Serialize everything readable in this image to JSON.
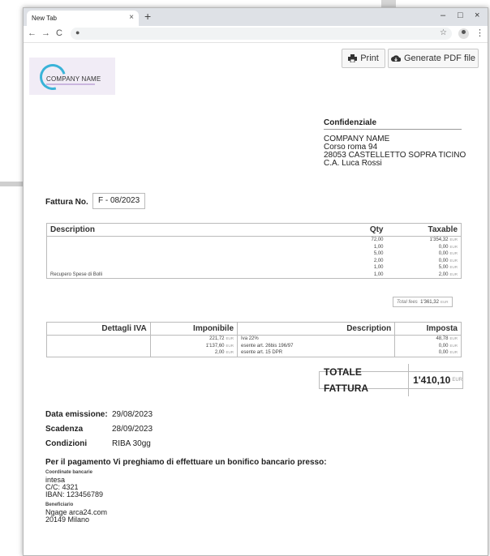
{
  "browser": {
    "tab_title": "New Tab",
    "tab_close": "×",
    "new_tab": "+",
    "minimize": "–",
    "maximize": "□",
    "close": "×",
    "back": "←",
    "forward": "→",
    "reload": "C",
    "lock": "●",
    "star": "☆",
    "menu": "⋮"
  },
  "actions": {
    "print_label": "Print",
    "pdf_label": "Generate PDF file"
  },
  "logo": {
    "text": "COMPANY NAME"
  },
  "recipient": {
    "heading": "Confidenziale",
    "lines": [
      "COMPANY NAME",
      "Corso roma 94",
      "28053 CASTELLETTO SOPRA TICINO",
      "C.A. Luca Rossi"
    ]
  },
  "invoice": {
    "label": "Fattura No.",
    "number": "F - 08/2023"
  },
  "items": {
    "headers": {
      "description": "Description",
      "qty": "Qty",
      "taxable": "Taxable"
    },
    "rows": [
      {
        "description": "",
        "qty": "72,00",
        "taxable": "1'354,32"
      },
      {
        "description": "",
        "qty": "1,00",
        "taxable": "0,00"
      },
      {
        "description": "",
        "qty": "5,00",
        "taxable": "0,00"
      },
      {
        "description": "",
        "qty": "2,00",
        "taxable": "0,00"
      },
      {
        "description": "",
        "qty": "1,00",
        "taxable": "5,00"
      },
      {
        "description": "Recupero Spese di Bolli",
        "qty": "1,00",
        "taxable": "2,00"
      }
    ],
    "currency": "EUR",
    "total_fees_label": "Total fees",
    "total_fees_value": "1'361,32"
  },
  "vat": {
    "headers": {
      "details": "Dettagli IVA",
      "taxable": "Imponibile",
      "description": "Description",
      "tax": "Imposta"
    },
    "rows": [
      {
        "taxable": "221,72",
        "description": "Iva 22%",
        "tax": "48,78"
      },
      {
        "taxable": "1'137,60",
        "description": "esente art. 26bis 196/97",
        "tax": "0,00"
      },
      {
        "taxable": "2,00",
        "description": "esente art. 15 DPR",
        "tax": "0,00"
      }
    ]
  },
  "total": {
    "label": "TOTALE FATTURA",
    "value": "1'410,10",
    "currency": "EUR"
  },
  "dates": {
    "issue_label": "Data emissione:",
    "issue_value": "29/08/2023",
    "due_label": "Scadenza",
    "due_value": "28/09/2023",
    "terms_label": "Condizioni",
    "terms_value": "RIBA 30gg"
  },
  "payment": {
    "heading": "Per il pagamento Vi preghiamo di effettuare un bonifico bancario presso:",
    "bank_label": "Coordinate bancarie",
    "bank_lines": [
      "intesa",
      "C/C: 4321",
      "IBAN: 123456789"
    ],
    "beneficiary_label": "Beneficiario",
    "beneficiary_lines": [
      "Ngage arca24.com",
      "20149 Milano"
    ]
  }
}
